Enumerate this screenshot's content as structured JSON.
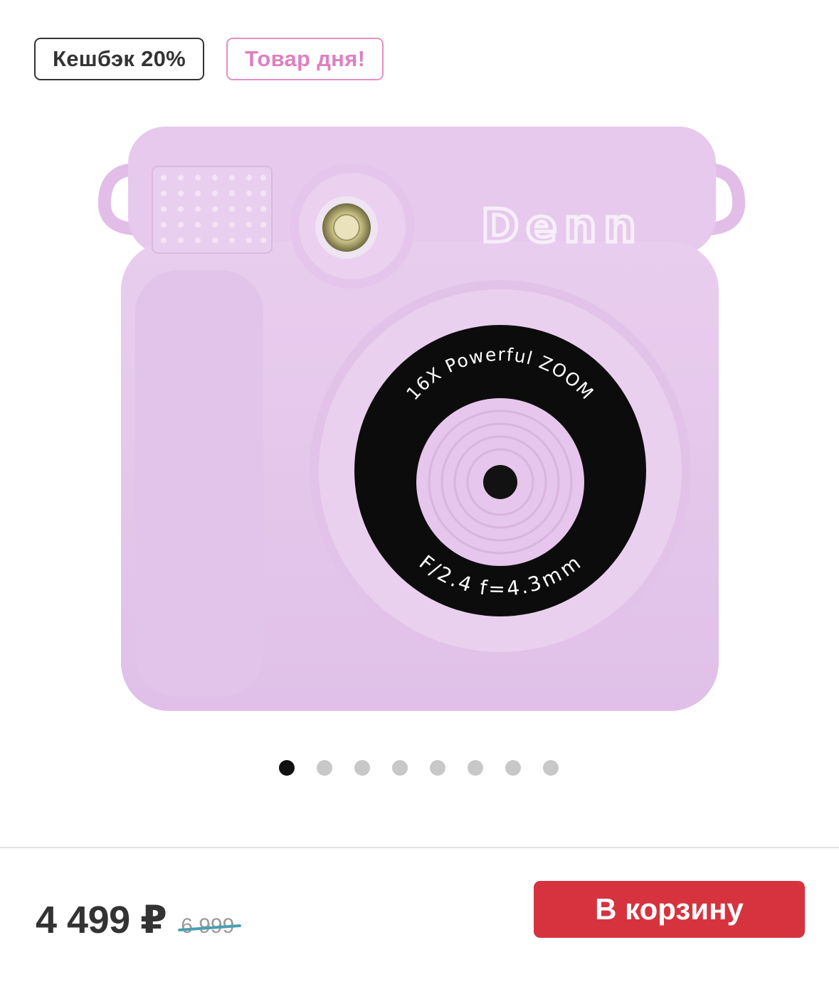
{
  "badges": {
    "cashback": "Кешбэк 20%",
    "deal": "Товар дня!"
  },
  "product": {
    "image_alt": "DENN kids instant camera, lilac",
    "brand_logo": "Denn",
    "lens_top_text": "16X Powerful ZOOM",
    "lens_bottom_text": "F/2.4 f=4.3mm"
  },
  "gallery": {
    "total_images": 8,
    "active_index": 0
  },
  "pricing": {
    "price": "4 499 ₽",
    "old_price": "6 999"
  },
  "actions": {
    "add_to_cart": "В корзину"
  },
  "colors": {
    "accent_button": "#d6333f",
    "deal_badge": "#e07fbf",
    "camera_body": "#e6c8ec",
    "strike": "#4a9fb0"
  }
}
